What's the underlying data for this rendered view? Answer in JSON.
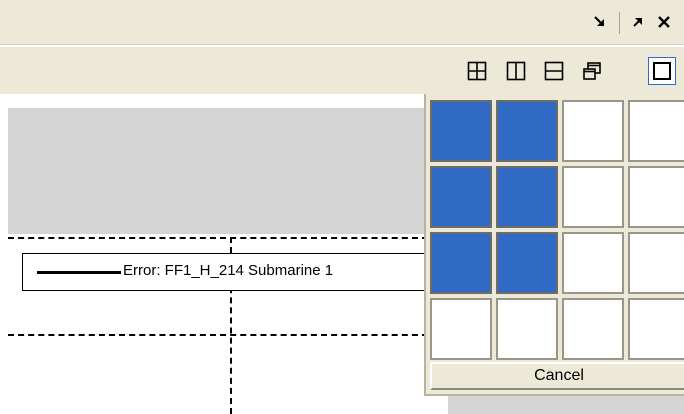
{
  "titlebar": {
    "buttons": [
      {
        "name": "dock-icon",
        "glyph": "↘"
      },
      {
        "name": "undock-icon",
        "glyph": "↗"
      },
      {
        "name": "close-icon",
        "glyph": "✕"
      }
    ]
  },
  "toolbar": {
    "layouts": [
      {
        "name": "grid-2x2-icon"
      },
      {
        "name": "split-vertical-icon"
      },
      {
        "name": "split-horizontal-icon"
      },
      {
        "name": "cascade-windows-icon"
      },
      {
        "name": "single-pane-icon",
        "active": true
      }
    ]
  },
  "legend": {
    "label": "Error: FF1_H_214 Submarine 1"
  },
  "layout_picker": {
    "rows": 4,
    "columns": 4,
    "selected_rows": 3,
    "selected_columns": 2,
    "cancel_label": "Cancel"
  },
  "colors": {
    "chrome": "#ece9d8",
    "selection": "#316ac5",
    "pane": "#d4d4d4"
  }
}
